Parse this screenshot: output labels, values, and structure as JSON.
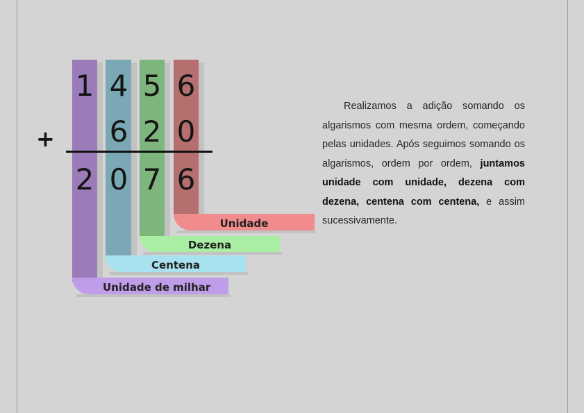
{
  "operation": {
    "operator": "+",
    "rows": [
      {
        "digits": [
          "1",
          "4",
          "5",
          "6"
        ]
      },
      {
        "digits": [
          "",
          "6",
          "2",
          "0"
        ]
      },
      {
        "digits": [
          "2",
          "0",
          "7",
          "6"
        ]
      }
    ]
  },
  "columns": [
    {
      "label": "Unidade de milhar",
      "color": "#9b7bb8",
      "tab_color": "#c09de8"
    },
    {
      "label": "Centena",
      "color": "#7aa8b4",
      "tab_color": "#a8e2ee"
    },
    {
      "label": "Dezena",
      "color": "#7db57c",
      "tab_color": "#a9eea2"
    },
    {
      "label": "Unidade",
      "color": "#b56f6f",
      "tab_color": "#f08c8c"
    }
  ],
  "explanation": {
    "text_1": "Realizamos a adição somando os algarismos com mesma ordem, começando pelas unidades. Após seguimos somando os algarismos, ordem por ordem, ",
    "bold": "juntamos unidade com unidade, dezena com dezena, centena com centena,",
    "text_2": " e assim sucessivamente."
  }
}
